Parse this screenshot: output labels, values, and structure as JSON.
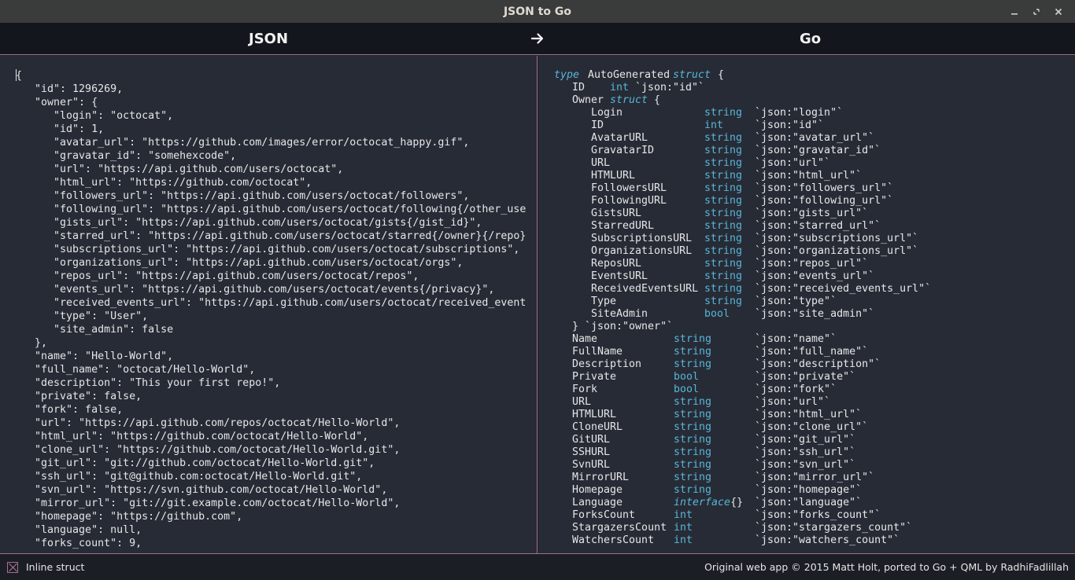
{
  "window": {
    "title": "JSON to Go",
    "buttons": [
      "minimize-icon",
      "restore-icon",
      "close-icon"
    ]
  },
  "header": {
    "left_label": "JSON",
    "right_label": "Go",
    "arrow_icon": "arrow-right-icon"
  },
  "json_input": {
    "lines": [
      "{",
      "   \"id\": 1296269,",
      "   \"owner\": {",
      "      \"login\": \"octocat\",",
      "      \"id\": 1,",
      "      \"avatar_url\": \"https://github.com/images/error/octocat_happy.gif\",",
      "      \"gravatar_id\": \"somehexcode\",",
      "      \"url\": \"https://api.github.com/users/octocat\",",
      "      \"html_url\": \"https://github.com/octocat\",",
      "      \"followers_url\": \"https://api.github.com/users/octocat/followers\",",
      "      \"following_url\": \"https://api.github.com/users/octocat/following{/other_use",
      "      \"gists_url\": \"https://api.github.com/users/octocat/gists{/gist_id}\",",
      "      \"starred_url\": \"https://api.github.com/users/octocat/starred{/owner}{/repo}",
      "      \"subscriptions_url\": \"https://api.github.com/users/octocat/subscriptions\",",
      "      \"organizations_url\": \"https://api.github.com/users/octocat/orgs\",",
      "      \"repos_url\": \"https://api.github.com/users/octocat/repos\",",
      "      \"events_url\": \"https://api.github.com/users/octocat/events{/privacy}\",",
      "      \"received_events_url\": \"https://api.github.com/users/octocat/received_event",
      "      \"type\": \"User\",",
      "      \"site_admin\": false",
      "   },",
      "   \"name\": \"Hello-World\",",
      "   \"full_name\": \"octocat/Hello-World\",",
      "   \"description\": \"This your first repo!\",",
      "   \"private\": false,",
      "   \"fork\": false,",
      "   \"url\": \"https://api.github.com/repos/octocat/Hello-World\",",
      "   \"html_url\": \"https://github.com/octocat/Hello-World\",",
      "   \"clone_url\": \"https://github.com/octocat/Hello-World.git\",",
      "   \"git_url\": \"git://github.com/octocat/Hello-World.git\",",
      "   \"ssh_url\": \"git@github.com:octocat/Hello-World.git\",",
      "   \"svn_url\": \"https://svn.github.com/octocat/Hello-World\",",
      "   \"mirror_url\": \"git://git.example.com/octocat/Hello-World\",",
      "   \"homepage\": \"https://github.com\",",
      "   \"language\": null,",
      "   \"forks_count\": 9,"
    ]
  },
  "go_output": {
    "type_keyword": "type",
    "struct_name": "AutoGenerated",
    "struct_keyword": "struct",
    "open_brace": "{",
    "top_fields_before": [
      {
        "name": "ID",
        "type": "int",
        "tag": "`json:\"id\"`"
      }
    ],
    "owner_field": {
      "name": "Owner",
      "keyword": "struct",
      "brace": "{",
      "closing": "}",
      "tag": "`json:\"owner\"`"
    },
    "owner_fields": [
      {
        "name": "Login",
        "type": "string",
        "tag": "`json:\"login\"`"
      },
      {
        "name": "ID",
        "type": "int",
        "tag": "`json:\"id\"`"
      },
      {
        "name": "AvatarURL",
        "type": "string",
        "tag": "`json:\"avatar_url\"`"
      },
      {
        "name": "GravatarID",
        "type": "string",
        "tag": "`json:\"gravatar_id\"`"
      },
      {
        "name": "URL",
        "type": "string",
        "tag": "`json:\"url\"`"
      },
      {
        "name": "HTMLURL",
        "type": "string",
        "tag": "`json:\"html_url\"`"
      },
      {
        "name": "FollowersURL",
        "type": "string",
        "tag": "`json:\"followers_url\"`"
      },
      {
        "name": "FollowingURL",
        "type": "string",
        "tag": "`json:\"following_url\"`"
      },
      {
        "name": "GistsURL",
        "type": "string",
        "tag": "`json:\"gists_url\"`"
      },
      {
        "name": "StarredURL",
        "type": "string",
        "tag": "`json:\"starred_url\"`"
      },
      {
        "name": "SubscriptionsURL",
        "type": "string",
        "tag": "`json:\"subscriptions_url\"`"
      },
      {
        "name": "OrganizationsURL",
        "type": "string",
        "tag": "`json:\"organizations_url\"`"
      },
      {
        "name": "ReposURL",
        "type": "string",
        "tag": "`json:\"repos_url\"`"
      },
      {
        "name": "EventsURL",
        "type": "string",
        "tag": "`json:\"events_url\"`"
      },
      {
        "name": "ReceivedEventsURL",
        "type": "string",
        "tag": "`json:\"received_events_url\"`"
      },
      {
        "name": "Type",
        "type": "string",
        "tag": "`json:\"type\"`"
      },
      {
        "name": "SiteAdmin",
        "type": "bool",
        "tag": "`json:\"site_admin\"`"
      }
    ],
    "top_fields_after": [
      {
        "name": "Name",
        "type": "string",
        "tag": "`json:\"name\"`"
      },
      {
        "name": "FullName",
        "type": "string",
        "tag": "`json:\"full_name\"`"
      },
      {
        "name": "Description",
        "type": "string",
        "tag": "`json:\"description\"`"
      },
      {
        "name": "Private",
        "type": "bool",
        "tag": "`json:\"private\"`"
      },
      {
        "name": "Fork",
        "type": "bool",
        "tag": "`json:\"fork\"`"
      },
      {
        "name": "URL",
        "type": "string",
        "tag": "`json:\"url\"`"
      },
      {
        "name": "HTMLURL",
        "type": "string",
        "tag": "`json:\"html_url\"`"
      },
      {
        "name": "CloneURL",
        "type": "string",
        "tag": "`json:\"clone_url\"`"
      },
      {
        "name": "GitURL",
        "type": "string",
        "tag": "`json:\"git_url\"`"
      },
      {
        "name": "SSHURL",
        "type": "string",
        "tag": "`json:\"ssh_url\"`"
      },
      {
        "name": "SvnURL",
        "type": "string",
        "tag": "`json:\"svn_url\"`"
      },
      {
        "name": "MirrorURL",
        "type": "string",
        "tag": "`json:\"mirror_url\"`"
      },
      {
        "name": "Homepage",
        "type": "string",
        "tag": "`json:\"homepage\"`"
      },
      {
        "name": "Language",
        "type": "interface{}",
        "tag": "`json:\"language\"`"
      },
      {
        "name": "ForksCount",
        "type": "int",
        "tag": "`json:\"forks_count\"`"
      },
      {
        "name": "StargazersCount",
        "type": "int",
        "tag": "`json:\"stargazers_count\"`"
      },
      {
        "name": "WatchersCount",
        "type": "int",
        "tag": "`json:\"watchers_count\"`"
      }
    ]
  },
  "footer": {
    "checkbox_label": "Inline struct",
    "checkbox_checked": true,
    "credit": "Original web app © 2015 Matt Holt, ported to Go + QML by RadhiFadlillah"
  },
  "colors": {
    "accent": "#a3708f",
    "go_type": "#58b6d6",
    "pane_bg": "#272b36",
    "header_bg": "#13161d"
  }
}
